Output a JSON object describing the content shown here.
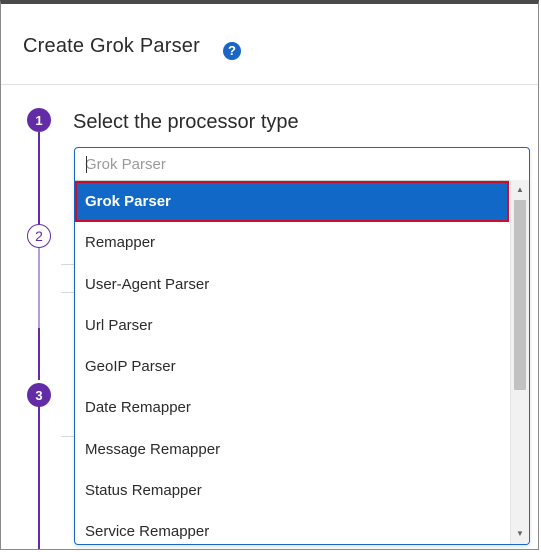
{
  "dialog": {
    "title": "Create Grok Parser",
    "help_icon": "question-circle-icon",
    "help_glyph": "?"
  },
  "steps": [
    {
      "number": "1",
      "label": "Select the processor type",
      "state": "active"
    },
    {
      "number": "2",
      "state": "upcoming"
    },
    {
      "number": "3",
      "state": "active"
    }
  ],
  "processor_select": {
    "placeholder": "Grok Parser",
    "selected": "Grok Parser",
    "options": [
      "Grok Parser",
      "Remapper",
      "User-Agent Parser",
      "Url Parser",
      "GeoIP Parser",
      "Date Remapper",
      "Message Remapper",
      "Status Remapper",
      "Service Remapper"
    ]
  },
  "colors": {
    "accent": "#632ca6",
    "selection": "#1168c7",
    "highlight_border": "#c8102e",
    "help": "#1a66c4"
  }
}
